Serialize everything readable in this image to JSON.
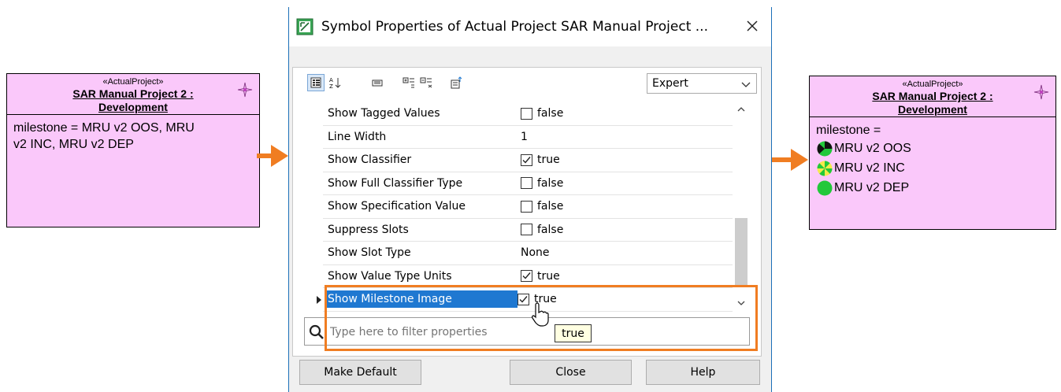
{
  "dialog": {
    "title": "Symbol Properties of Actual Project SAR Manual Project ...",
    "mode": "Expert",
    "filter_placeholder": "Type here to filter properties",
    "tooltip": "true",
    "buttons": {
      "make_default": "Make Default",
      "close": "Close",
      "help": "Help"
    },
    "properties": [
      {
        "name": "Show Tagged Values",
        "type": "checkbox",
        "checked": false,
        "value": "false"
      },
      {
        "name": "Line Width",
        "type": "text",
        "value": "1"
      },
      {
        "name": "Show Classifier",
        "type": "checkbox",
        "checked": true,
        "value": "true"
      },
      {
        "name": "Show Full Classifier Type",
        "type": "checkbox",
        "checked": false,
        "value": "false"
      },
      {
        "name": "Show Specification Value",
        "type": "checkbox",
        "checked": false,
        "value": "false"
      },
      {
        "name": "Suppress Slots",
        "type": "checkbox",
        "checked": false,
        "value": "false"
      },
      {
        "name": "Show Slot Type",
        "type": "text",
        "value": "None"
      },
      {
        "name": "Show Value Type Units",
        "type": "checkbox",
        "checked": true,
        "value": "true"
      },
      {
        "name": "Show Milestone Image",
        "type": "checkbox",
        "checked": true,
        "value": "true",
        "selected": true
      }
    ]
  },
  "left_symbol": {
    "stereotype": "«ActualProject»",
    "name_line1": "SAR Manual Project 2 :",
    "name_line2": "Development",
    "slot_line1": "milestone = MRU v2 OOS, MRU",
    "slot_line2": "v2 INC, MRU v2 DEP"
  },
  "right_symbol": {
    "stereotype": "«ActualProject»",
    "name_line1": "SAR Manual Project 2 :",
    "name_line2": "Development",
    "slot_label": "milestone =",
    "milestones": [
      {
        "label": "MRU v2 OOS",
        "icon": "milestone-oos-icon"
      },
      {
        "label": "MRU v2 INC",
        "icon": "milestone-inc-icon"
      },
      {
        "label": "MRU v2 DEP",
        "icon": "milestone-dep-icon"
      }
    ]
  },
  "colors": {
    "symbol_fill": "#fac8fa",
    "highlight": "#f07d22",
    "selection": "#1f78d1",
    "milestone_green": "#22c83a"
  }
}
